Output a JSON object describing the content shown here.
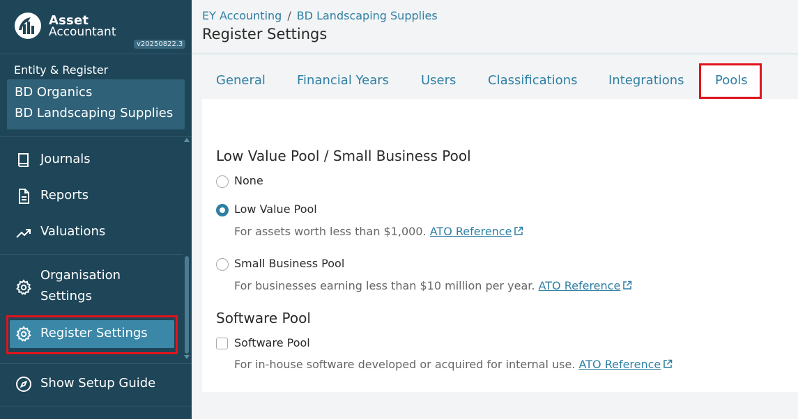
{
  "sidebar": {
    "logo": {
      "line1": "Asset",
      "line2": "Accountant",
      "version": "v20250822.3"
    },
    "entity_label": "Entity & Register",
    "entity_name": "BD Organics",
    "register_name": "BD Landscaping Supplies",
    "nav": [
      {
        "label": "Journals",
        "icon": "book-icon"
      },
      {
        "label": "Reports",
        "icon": "document-icon"
      },
      {
        "label": "Valuations",
        "icon": "trend-up-icon"
      },
      {
        "label_line1": "Organisation",
        "label_line2": "Settings",
        "icon": "gear-icon"
      },
      {
        "label": "Register Settings",
        "icon": "gear-icon",
        "active": true
      },
      {
        "label": "Show Setup Guide",
        "icon": "compass-icon"
      }
    ]
  },
  "header": {
    "breadcrumb": [
      "EY Accounting",
      "BD Landscaping Supplies"
    ],
    "breadcrumb_separator": "/",
    "title": "Register Settings"
  },
  "tabs": [
    {
      "label": "General"
    },
    {
      "label": "Financial Years"
    },
    {
      "label": "Users"
    },
    {
      "label": "Classifications"
    },
    {
      "label": "Integrations"
    },
    {
      "label": "Pools",
      "active": true
    }
  ],
  "pools": {
    "low_value_title": "Low Value Pool / Small Business Pool",
    "options": [
      {
        "label": "None",
        "selected": false
      },
      {
        "label": "Low Value Pool",
        "selected": true,
        "description": "For assets worth less than $1,000.",
        "link": "ATO Reference"
      },
      {
        "label": "Small Business Pool",
        "selected": false,
        "description": "For businesses earning less than $10 million per year.",
        "link": "ATO Reference"
      }
    ],
    "software_title": "Software Pool",
    "software": {
      "label": "Software Pool",
      "checked": false,
      "description": "For in-house software developed or acquired for internal use.",
      "link": "ATO Reference"
    }
  },
  "colors": {
    "sidebar_bg": "#1e4558",
    "accent": "#2f7fa4",
    "active_nav": "#3a87a8",
    "highlight": "#e1131b"
  }
}
